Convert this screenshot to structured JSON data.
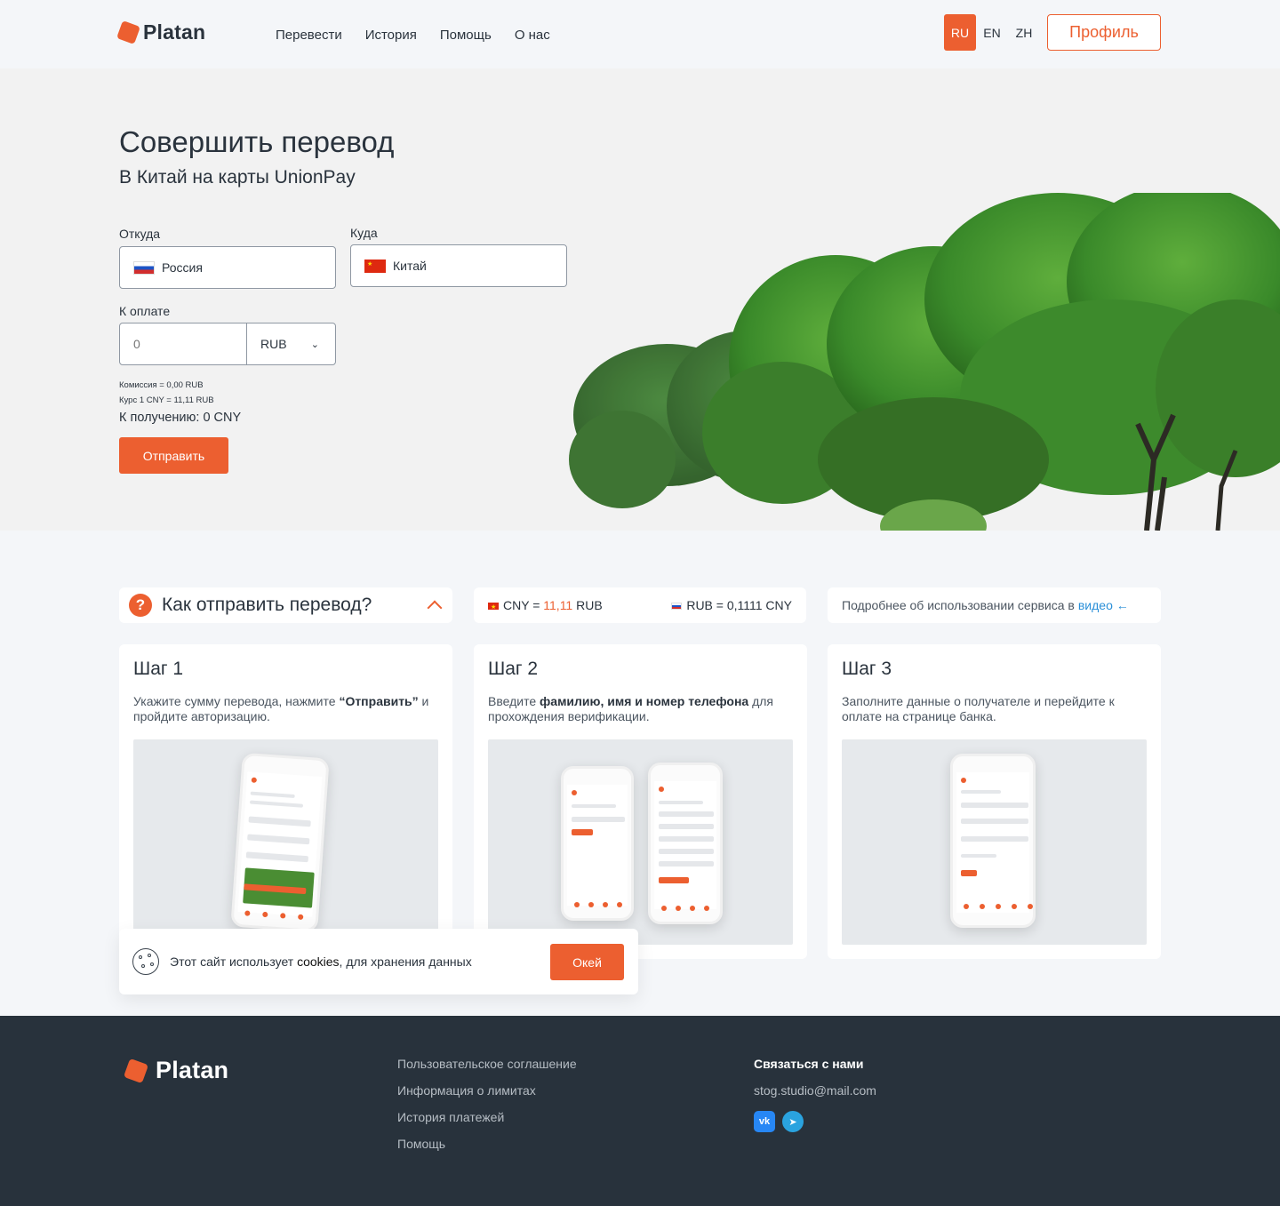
{
  "header": {
    "brand": "Platan",
    "nav": [
      "Перевести",
      "История",
      "Помощь",
      "О нас"
    ],
    "languages": [
      "RU",
      "EN",
      "ZH"
    ],
    "active_language": "RU",
    "profile_label": "Профиль"
  },
  "hero": {
    "title": "Совершить перевод",
    "subtitle": "В Китай на карты UnionPay",
    "from_label": "Откуда",
    "from_value": "Россия",
    "to_label": "Куда",
    "to_value": "Китай",
    "amount_label": "К оплате",
    "amount_placeholder": "0",
    "currency": "RUB",
    "commission": "Комиссия = 0,00 RUB",
    "rate": "Курс 1 CNY = 11,11 RUB",
    "receive": "К получению: 0 CNY",
    "send_label": "Отправить"
  },
  "how": {
    "title": "Как отправить перевод?",
    "rate_left_prefix": "CNY = ",
    "rate_left_value": "11,11",
    "rate_left_suffix": " RUB",
    "rate_right": "RUB = 0,1111 CNY",
    "video_text": "Подробнее об использовании сервиса в",
    "video_link": "видео ←",
    "steps": [
      {
        "title": "Шаг 1",
        "text_before": "Укажите сумму перевода, нажмите ",
        "text_bold": "“Отправить”",
        "text_after": " и пройдите авторизацию."
      },
      {
        "title": "Шаг 2",
        "text_before": "Введите ",
        "text_bold": "фамилию, имя и номер телефона",
        "text_after": " для прохождения верификации."
      },
      {
        "title": "Шаг 3",
        "text_before": "Заполните данные о получателе и перейдите к оплате на странице банка.",
        "text_bold": "",
        "text_after": ""
      }
    ]
  },
  "cookie": {
    "text_before": "Этот сайт использует ",
    "text_bold": "cookies",
    "text_after": ", для хранения данных",
    "ok_label": "Окей"
  },
  "footer": {
    "brand": "Platan",
    "links": [
      "Пользовательское соглашение",
      "Информация о лимитах",
      "История платежей",
      "Помощь"
    ],
    "contact_title": "Связаться с нами",
    "email": "stog.studio@mail.com"
  },
  "colors": {
    "accent": "#ec5f30",
    "footer_bg": "#28323c",
    "link": "#2a8fd8"
  }
}
